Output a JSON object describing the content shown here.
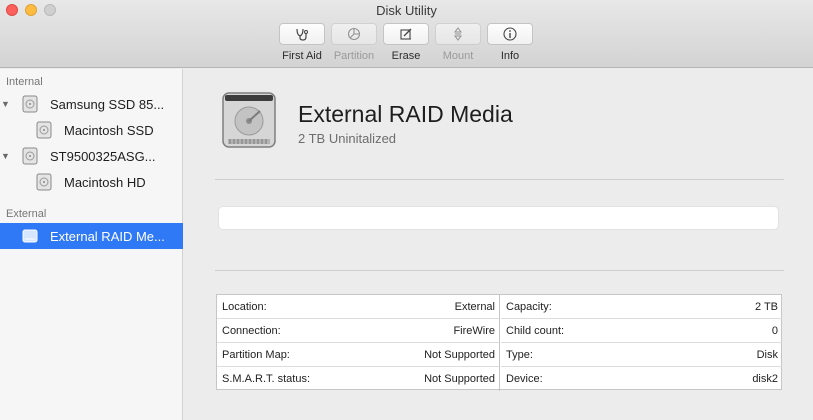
{
  "window": {
    "title": "Disk Utility"
  },
  "toolbar": {
    "first_aid": "First Aid",
    "partition": "Partition",
    "erase": "Erase",
    "mount": "Mount",
    "info": "Info"
  },
  "sidebar": {
    "internal_header": "Internal",
    "external_header": "External",
    "items": [
      {
        "label": "Samsung SSD 85...",
        "level": 0
      },
      {
        "label": "Macintosh SSD",
        "level": 1
      },
      {
        "label": "ST9500325ASG...",
        "level": 0
      },
      {
        "label": "Macintosh HD",
        "level": 1
      },
      {
        "label": "External RAID Me...",
        "level": 0,
        "selected": true
      }
    ]
  },
  "volume": {
    "name": "External RAID Media",
    "subtitle": "2 TB Uninitalized"
  },
  "info": {
    "left": [
      {
        "key": "Location:",
        "value": "External"
      },
      {
        "key": "Connection:",
        "value": "FireWire"
      },
      {
        "key": "Partition Map:",
        "value": "Not Supported"
      },
      {
        "key": "S.M.A.R.T. status:",
        "value": "Not Supported"
      }
    ],
    "right": [
      {
        "key": "Capacity:",
        "value": "2 TB"
      },
      {
        "key": "Child count:",
        "value": "0"
      },
      {
        "key": "Type:",
        "value": "Disk"
      },
      {
        "key": "Device:",
        "value": "disk2"
      }
    ]
  },
  "colors": {
    "selection": "#2f78f6",
    "close": "#fc605c",
    "minimize": "#fdbc40"
  }
}
